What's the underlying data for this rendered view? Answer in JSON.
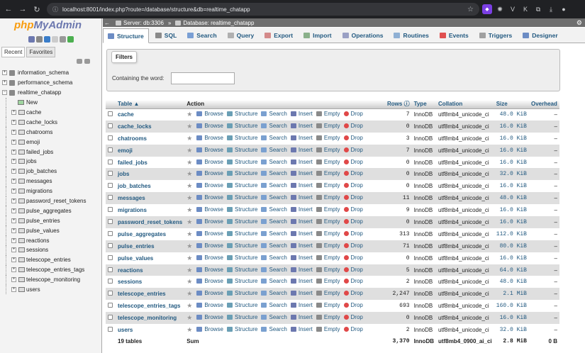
{
  "browser": {
    "url": "localhost:8001/index.php?route=/database/structure&db=realtime_chatapp"
  },
  "left": {
    "logo_php": "php",
    "logo_myadmin": "MyAdmin",
    "tab_recent": "Recent",
    "tab_favorites": "Favorites",
    "databases": [
      "information_schema",
      "performance_schema",
      "realtime_chatapp"
    ],
    "new_label": "New",
    "tables": [
      "cache",
      "cache_locks",
      "chatrooms",
      "emoji",
      "failed_jobs",
      "jobs",
      "job_batches",
      "messages",
      "migrations",
      "password_reset_tokens",
      "pulse_aggregates",
      "pulse_entries",
      "pulse_values",
      "reactions",
      "sessions",
      "telescope_entries",
      "telescope_entries_tags",
      "telescope_monitoring",
      "users"
    ]
  },
  "crumbs": {
    "server": "Server: db:3306",
    "database": "Database: realtime_chatapp"
  },
  "tabs": [
    "Structure",
    "SQL",
    "Search",
    "Query",
    "Export",
    "Import",
    "Operations",
    "Routines",
    "Events",
    "Triggers",
    "Designer"
  ],
  "filters": {
    "legend": "Filters",
    "label": "Containing the word:",
    "value": ""
  },
  "table": {
    "headers": {
      "table": "Table",
      "action": "Action",
      "rows": "Rows",
      "type": "Type",
      "collation": "Collation",
      "size": "Size",
      "overhead": "Overhead"
    },
    "actions": {
      "browse": "Browse",
      "structure": "Structure",
      "search": "Search",
      "insert": "Insert",
      "empty": "Empty",
      "drop": "Drop"
    },
    "rows": [
      {
        "name": "cache",
        "rows": "7",
        "type": "InnoDB",
        "collation": "utf8mb4_unicode_ci",
        "size": "48.0 KiB",
        "overhead": "–"
      },
      {
        "name": "cache_locks",
        "rows": "0",
        "type": "InnoDB",
        "collation": "utf8mb4_unicode_ci",
        "size": "16.0 KiB",
        "overhead": "–"
      },
      {
        "name": "chatrooms",
        "rows": "3",
        "type": "InnoDB",
        "collation": "utf8mb4_unicode_ci",
        "size": "16.0 KiB",
        "overhead": "–"
      },
      {
        "name": "emoji",
        "rows": "7",
        "type": "InnoDB",
        "collation": "utf8mb4_unicode_ci",
        "size": "16.0 KiB",
        "overhead": "–"
      },
      {
        "name": "failed_jobs",
        "rows": "0",
        "type": "InnoDB",
        "collation": "utf8mb4_unicode_ci",
        "size": "16.0 KiB",
        "overhead": "–"
      },
      {
        "name": "jobs",
        "rows": "0",
        "type": "InnoDB",
        "collation": "utf8mb4_unicode_ci",
        "size": "32.0 KiB",
        "overhead": "–"
      },
      {
        "name": "job_batches",
        "rows": "0",
        "type": "InnoDB",
        "collation": "utf8mb4_unicode_ci",
        "size": "16.0 KiB",
        "overhead": "–"
      },
      {
        "name": "messages",
        "rows": "11",
        "type": "InnoDB",
        "collation": "utf8mb4_unicode_ci",
        "size": "48.0 KiB",
        "overhead": "–"
      },
      {
        "name": "migrations",
        "rows": "9",
        "type": "InnoDB",
        "collation": "utf8mb4_unicode_ci",
        "size": "16.0 KiB",
        "overhead": "–"
      },
      {
        "name": "password_reset_tokens",
        "rows": "0",
        "type": "InnoDB",
        "collation": "utf8mb4_unicode_ci",
        "size": "16.0 KiB",
        "overhead": "–"
      },
      {
        "name": "pulse_aggregates",
        "rows": "313",
        "type": "InnoDB",
        "collation": "utf8mb4_unicode_ci",
        "size": "112.0 KiB",
        "overhead": "–"
      },
      {
        "name": "pulse_entries",
        "rows": "71",
        "type": "InnoDB",
        "collation": "utf8mb4_unicode_ci",
        "size": "80.0 KiB",
        "overhead": "–"
      },
      {
        "name": "pulse_values",
        "rows": "0",
        "type": "InnoDB",
        "collation": "utf8mb4_unicode_ci",
        "size": "16.0 KiB",
        "overhead": "–"
      },
      {
        "name": "reactions",
        "rows": "5",
        "type": "InnoDB",
        "collation": "utf8mb4_unicode_ci",
        "size": "64.0 KiB",
        "overhead": "–"
      },
      {
        "name": "sessions",
        "rows": "2",
        "type": "InnoDB",
        "collation": "utf8mb4_unicode_ci",
        "size": "48.0 KiB",
        "overhead": "–"
      },
      {
        "name": "telescope_entries",
        "rows": "2,247",
        "type": "InnoDB",
        "collation": "utf8mb4_unicode_ci",
        "size": "2.1 MiB",
        "overhead": "–"
      },
      {
        "name": "telescope_entries_tags",
        "rows": "693",
        "type": "InnoDB",
        "collation": "utf8mb4_unicode_ci",
        "size": "160.0 KiB",
        "overhead": "–"
      },
      {
        "name": "telescope_monitoring",
        "rows": "0",
        "type": "InnoDB",
        "collation": "utf8mb4_unicode_ci",
        "size": "16.0 KiB",
        "overhead": "–"
      },
      {
        "name": "users",
        "rows": "2",
        "type": "InnoDB",
        "collation": "utf8mb4_unicode_ci",
        "size": "32.0 KiB",
        "overhead": "–"
      }
    ],
    "footer": {
      "count": "19 tables",
      "sum": "Sum",
      "rows": "3,370",
      "type": "InnoDB",
      "collation": "utf8mb4_0900_ai_ci",
      "size": "2.8 MiB",
      "overhead": "0 B"
    }
  },
  "colors": {
    "link": "#235a81",
    "accent": "#f89c0e"
  }
}
